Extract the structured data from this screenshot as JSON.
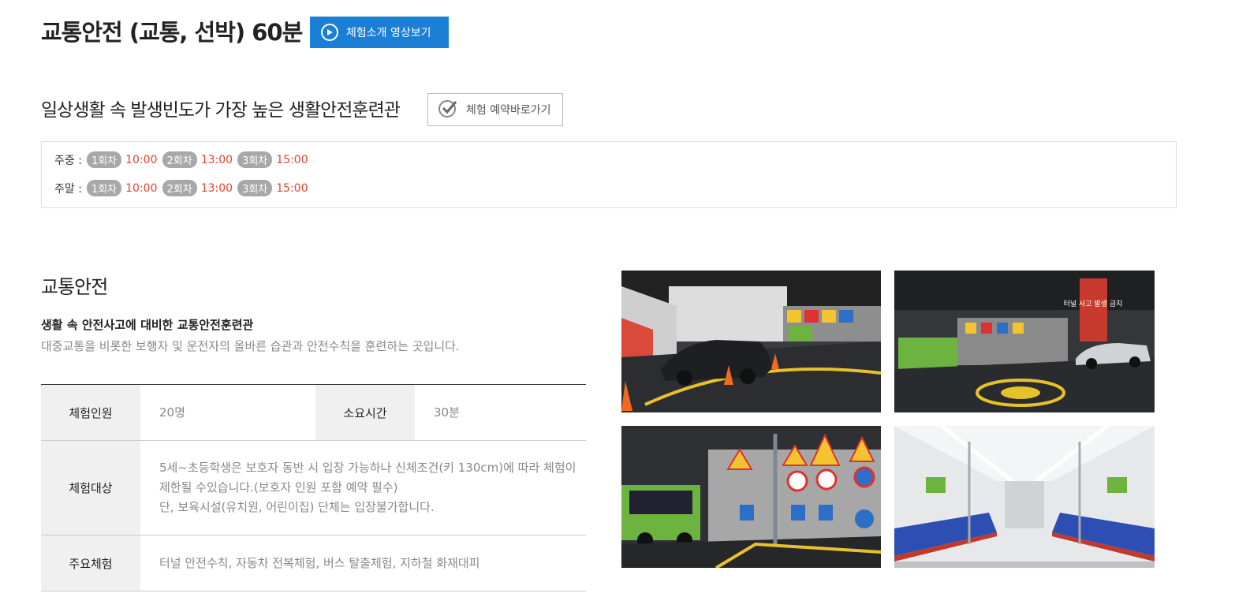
{
  "header": {
    "title": "교통안전 (교통, 선박) 60분",
    "video_button": "체험소개 영상보기"
  },
  "intro": {
    "subtitle": "일상생활 속 발생빈도가 가장 높은 생활안전훈련관",
    "reserve_button": "체험 예약바로가기"
  },
  "schedule": {
    "weekday": {
      "label": "주중 :",
      "sessions": [
        {
          "badge": "1회차",
          "time": "10:00"
        },
        {
          "badge": "2회차",
          "time": "13:00"
        },
        {
          "badge": "3회차",
          "time": "15:00"
        }
      ]
    },
    "weekend": {
      "label": "주말 :",
      "sessions": [
        {
          "badge": "1회차",
          "time": "10:00"
        },
        {
          "badge": "2회차",
          "time": "13:00"
        },
        {
          "badge": "3회차",
          "time": "15:00"
        }
      ]
    }
  },
  "section": {
    "title": "교통안전",
    "desc_bold": "생활 속 안전사고에 대비한 교통안전훈련관",
    "desc": "대중교통을 비롯한 보행자 및 운전자의 올바른 습관과 안전수칙을 훈련하는 곳입니다."
  },
  "info_table": {
    "people_label": "체험인원",
    "people_value": "20명",
    "duration_label": "소요시간",
    "duration_value": "30분",
    "target_label": "체험대상",
    "target_line1": "5세~초등학생은 보호자 동반 시 입장 가능하나 신체조건(키 130cm)에 따라 체험이",
    "target_line2": "제한될 수있습니다.(보호자 인원 포함 예약 필수)",
    "target_line3": "단, 보육시설(유치원, 어린이집) 단체는 입장불가합니다.",
    "main_label": "주요체험",
    "main_value": "터널 안전수칙, 자동차 전복체험, 버스 탈출체험, 지하철 화재대피"
  },
  "photos": {
    "photo2_sign": "터널 사고 발생 금지"
  },
  "colors": {
    "accent_blue": "#1b7fd6",
    "time_red": "#e0452c",
    "badge_gray": "#a8a8a8"
  }
}
